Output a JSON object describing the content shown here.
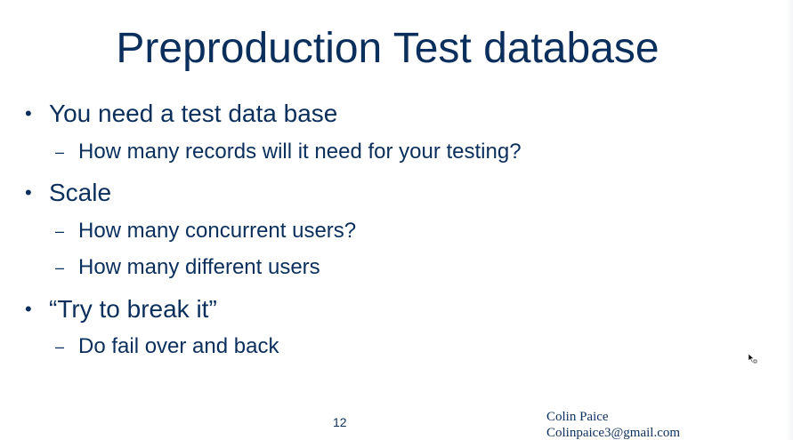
{
  "slide": {
    "title": "Preproduction Test database",
    "bullets": [
      {
        "text": "You need a test data base",
        "sub": [
          "How many records will it need for your testing?"
        ]
      },
      {
        "text": "Scale",
        "sub": [
          "How many concurrent users?",
          "How many different users"
        ]
      },
      {
        "text": "“Try to break it”",
        "sub": [
          "Do fail over and back"
        ]
      }
    ],
    "bullet_symbol": "•",
    "sub_symbol": "–",
    "page_number": "12",
    "author_name": "Colin Paice",
    "author_email": "Colinpaice3@gmail.com"
  },
  "icons": {
    "cursor": "mouse-pointer-icon"
  },
  "colors": {
    "text": "#0b2f5c",
    "background": "#ffffff"
  }
}
